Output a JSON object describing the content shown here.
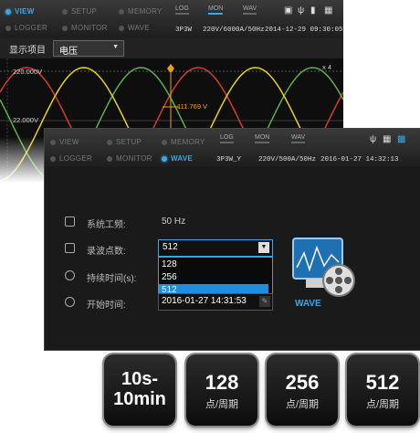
{
  "back": {
    "modes": [
      {
        "label": "VIEW",
        "active": true
      },
      {
        "label": "SETUP",
        "active": false
      },
      {
        "label": "MEMORY",
        "active": false
      },
      {
        "label": "LOGGER",
        "active": false
      },
      {
        "label": "MONITOR",
        "active": false
      },
      {
        "label": "WAVE",
        "active": false
      }
    ],
    "tabs": [
      "LOG",
      "MON",
      "WAV"
    ],
    "info": {
      "wiring": "3P3W",
      "rating": "220V/6000A/50Hz",
      "datetime": "2014-12-29 09:30:05"
    },
    "display_item_label": "显示项目",
    "display_item_value": "电压",
    "level_top": "220.000V",
    "level_bottom": "22.000V",
    "cursor_value": "111.769 V",
    "zoom": "x 4"
  },
  "front": {
    "modes": [
      {
        "label": "VIEW",
        "active": false
      },
      {
        "label": "SETUP",
        "active": false
      },
      {
        "label": "MEMORY",
        "active": false
      },
      {
        "label": "LOGGER",
        "active": false
      },
      {
        "label": "MONITOR",
        "active": false
      },
      {
        "label": "WAVE",
        "active": true
      }
    ],
    "tabs": [
      "LOG",
      "MON",
      "WAV"
    ],
    "info": {
      "wiring": "3P3W_Y",
      "rating": "220V/500A/50Hz",
      "datetime": "2016-01-27 14:32:13"
    },
    "rows": {
      "freq_label": "系统工频:",
      "freq_value": "50 Hz",
      "points_label": "录波点数:",
      "points_value": "512",
      "duration_label": "持续时间(s):",
      "start_label": "开始时间:",
      "start_value": "2016-01-27 14:31:53"
    },
    "dropdown_options": [
      "128",
      "256",
      "512"
    ],
    "selected_option": "512",
    "wave_caption": "WAVE"
  },
  "badges": [
    {
      "big1": "10s-",
      "big2": "10min",
      "small": ""
    },
    {
      "big1": "128",
      "big2": "",
      "small": "点/周期"
    },
    {
      "big1": "256",
      "big2": "",
      "small": "点/周期"
    },
    {
      "big1": "512",
      "big2": "",
      "small": "点/周期"
    }
  ],
  "colors": {
    "accent": "#3aa7e8",
    "selected": "#1f8de0",
    "wave_red": "#d43b2b",
    "wave_green": "#5db04a",
    "wave_yellow": "#e8d21d"
  }
}
